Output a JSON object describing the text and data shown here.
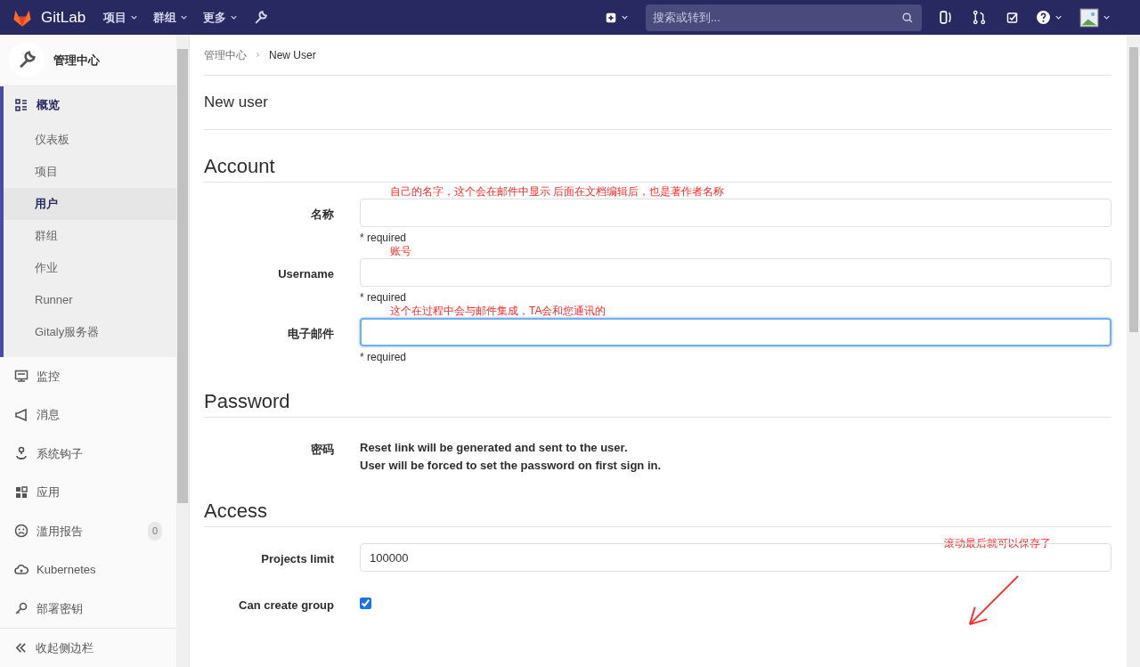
{
  "navbar": {
    "brand": "GitLab",
    "menus": [
      {
        "label": "项目"
      },
      {
        "label": "群组"
      },
      {
        "label": "更多"
      }
    ],
    "search": {
      "placeholder": "搜索或转到..."
    }
  },
  "sidebar": {
    "header": "管理中心",
    "items": [
      {
        "label": "概览",
        "selected": true,
        "children": [
          {
            "label": "仪表板",
            "selected": false
          },
          {
            "label": "项目",
            "selected": false
          },
          {
            "label": "用户",
            "selected": true
          },
          {
            "label": "群组",
            "selected": false
          },
          {
            "label": "作业",
            "selected": false
          },
          {
            "label": "Runner",
            "selected": false
          },
          {
            "label": "Gitaly服务器",
            "selected": false
          }
        ]
      },
      {
        "label": "监控",
        "selected": false
      },
      {
        "label": "消息",
        "selected": false
      },
      {
        "label": "系统钩子",
        "selected": false
      },
      {
        "label": "应用",
        "selected": false
      },
      {
        "label": "滥用报告",
        "selected": false,
        "badge": "0"
      },
      {
        "label": "Kubernetes",
        "selected": false
      },
      {
        "label": "部署密钥",
        "selected": false
      }
    ],
    "collapse": "收起侧边栏"
  },
  "breadcrumb": [
    "管理中心",
    "New User"
  ],
  "page_title": "New user",
  "sections": [
    {
      "title": "Account",
      "fields": [
        {
          "kind": "text",
          "label": "名称",
          "help": "* required",
          "focused": false,
          "annotation": "自己的名字，这个会在邮件中显示 后面在文档编辑后，也是著作者名称"
        },
        {
          "kind": "text",
          "label": "Username",
          "help": "* required",
          "focused": false,
          "annotation": "账号"
        },
        {
          "kind": "text",
          "label": "电子邮件",
          "help": "* required",
          "focused": true,
          "annotation": "这个在过程中会与邮件集成，TA会和您通讯的"
        }
      ]
    },
    {
      "title": "Password",
      "fields": [
        {
          "kind": "note",
          "label": "密码",
          "lines": [
            "Reset link will be generated and sent to the user.",
            "User will be forced to set the password on first sign in."
          ]
        }
      ]
    },
    {
      "title": "Access",
      "annotation": "滚动最后就可以保存了",
      "fields": [
        {
          "kind": "text",
          "label": "Projects limit",
          "value": "100000",
          "focused": false
        },
        {
          "kind": "checkbox",
          "label": "Can create group",
          "checked": true
        }
      ]
    }
  ]
}
